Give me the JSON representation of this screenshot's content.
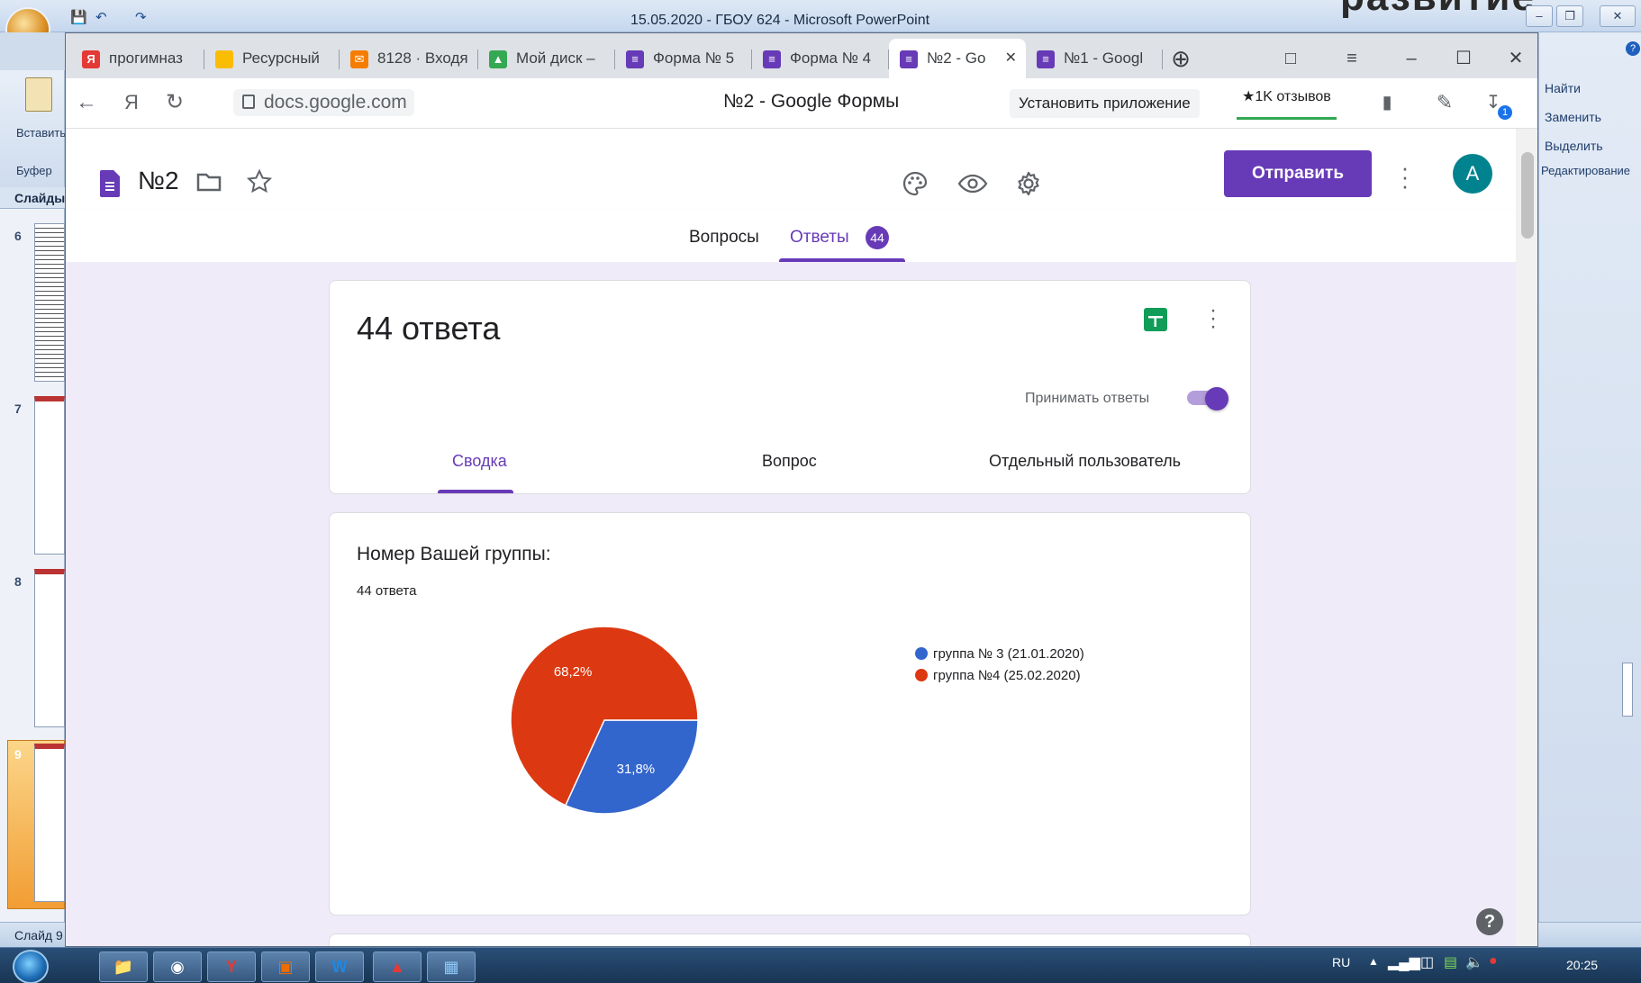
{
  "ppt": {
    "title_bar": "15.05.2020 - ГБОУ 624 - Microsoft PowerPoint",
    "big_text": "развитие",
    "ribbon_paste": "Вставить",
    "ribbon_clipboard": "Буфер",
    "slides_tab": "Слайды",
    "find": "Найти",
    "replace": "Заменить",
    "select": "Выделить",
    "editing": "Редактирование",
    "status": "Слайд 9",
    "slide_numbers": [
      "6",
      "7",
      "8",
      "9"
    ]
  },
  "taskbar": {
    "lang": "RU",
    "time": "20:25"
  },
  "browser": {
    "tabs": [
      {
        "label": "прогимназ",
        "icon_color": "#e53935",
        "icon_glyph": "Я"
      },
      {
        "label": "Ресурсный",
        "icon_color": "#fbbc04",
        "icon_glyph": ""
      },
      {
        "label": "8128 · Входя",
        "icon_color": "#f57c00",
        "icon_glyph": "✉"
      },
      {
        "label": "Мой диск –",
        "icon_color": "#34a853",
        "icon_glyph": "▲"
      },
      {
        "label": "Форма № 5",
        "icon_color": "#673ab7",
        "icon_glyph": "≡"
      },
      {
        "label": "Форма № 4",
        "icon_color": "#673ab7",
        "icon_glyph": "≡"
      },
      {
        "label": "№2 - Go",
        "icon_color": "#673ab7",
        "icon_glyph": "≡"
      },
      {
        "label": "№1 - Googl",
        "icon_color": "#673ab7",
        "icon_glyph": "≡"
      }
    ],
    "active_tab_index": 6,
    "url": "docs.google.com",
    "page_title": "№2 - Google Формы",
    "install_app": "Установить приложение",
    "reviews": "★1K отзывов",
    "download_badge": "1"
  },
  "form": {
    "title": "№2",
    "send_label": "Отправить",
    "avatar_letter": "A",
    "tabs": {
      "questions": "Вопросы",
      "answers": "Ответы",
      "answers_count": "44"
    },
    "summary_card": {
      "responses_title": "44 ответа",
      "accept_label": "Принимать ответы",
      "accepting": true,
      "subtabs": [
        "Сводка",
        "Вопрос",
        "Отдельный пользователь"
      ],
      "active_subtab": 0
    },
    "question_card": {
      "question": "Номер Вашей группы:",
      "count_label": "44 ответа"
    }
  },
  "chart_data": {
    "type": "pie",
    "categories": [
      "группа № 3 (21.01.2020)",
      "группа №4 (25.02.2020)"
    ],
    "values": [
      31.8,
      68.2
    ],
    "labels": [
      "31,8%",
      "68,2%"
    ],
    "colors": [
      "#3366cc",
      "#dc3912"
    ],
    "legend_position": "right"
  }
}
